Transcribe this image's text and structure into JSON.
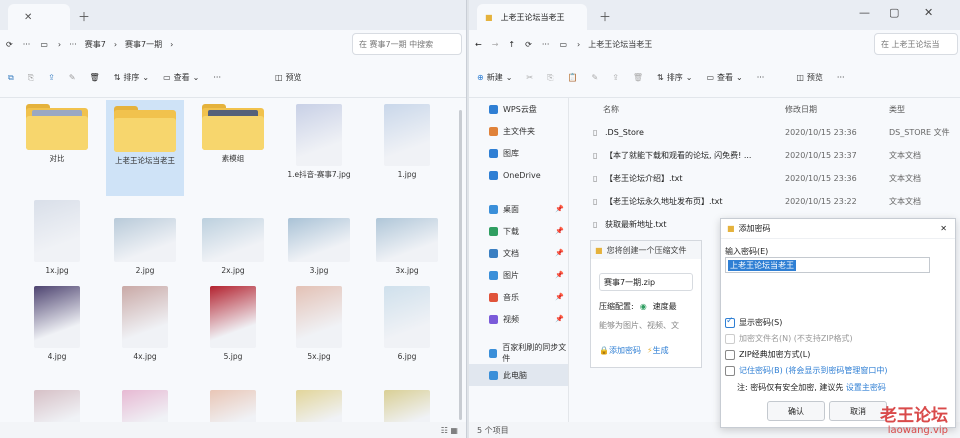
{
  "left": {
    "tab_label": "",
    "breadcrumb": [
      "赛事7",
      "赛事7一期"
    ],
    "search_placeholder": "在 赛事7一期 中搜索",
    "toolbar": {
      "sort": "排序",
      "view": "查看",
      "details": "预览"
    },
    "items": [
      {
        "label": "对比",
        "kind": "folder",
        "thumb": "#9aa8c2"
      },
      {
        "label": "上老王论坛当老王",
        "kind": "folder",
        "selected": true,
        "thumb": ""
      },
      {
        "label": "素模组",
        "kind": "folder",
        "thumb": "#55617a"
      },
      {
        "label": "1.e抖音-赛事7.jpg",
        "kind": "image",
        "thumb": "#c8d0e6"
      },
      {
        "label": "1.jpg",
        "kind": "image",
        "thumb": "#c9d7ea"
      },
      {
        "label": "1x.jpg",
        "kind": "image",
        "thumb": "#d9dfe9"
      },
      {
        "label": "2.jpg",
        "kind": "image",
        "thumb": "#b8cad9"
      },
      {
        "label": "2x.jpg",
        "kind": "image",
        "thumb": "#bcd0de"
      },
      {
        "label": "3.jpg",
        "kind": "image",
        "thumb": "#a9c2d6"
      },
      {
        "label": "3x.jpg",
        "kind": "image",
        "thumb": "#afc6d8"
      },
      {
        "label": "4.jpg",
        "kind": "image",
        "thumb": "#4d4370"
      },
      {
        "label": "4x.jpg",
        "kind": "image",
        "thumb": "#c9a9a6"
      },
      {
        "label": "5.jpg",
        "kind": "image",
        "thumb": "#b3222f"
      },
      {
        "label": "5x.jpg",
        "kind": "image",
        "thumb": "#e3c1b5"
      },
      {
        "label": "6.jpg",
        "kind": "image",
        "thumb": "#cfe0ec"
      },
      {
        "label": "",
        "kind": "image",
        "thumb": "#d6c0c6"
      },
      {
        "label": "",
        "kind": "image",
        "thumb": "#e7b9d3"
      },
      {
        "label": "",
        "kind": "image",
        "thumb": "#e9c6b6"
      },
      {
        "label": "",
        "kind": "image",
        "thumb": "#e2d59a"
      },
      {
        "label": "",
        "kind": "image",
        "thumb": "#d9cf95"
      }
    ]
  },
  "right": {
    "tab_label": "上老王论坛当老王",
    "breadcrumb": [
      "上老王论坛当老王"
    ],
    "search_placeholder": "在 上老王论坛当",
    "toolbar": {
      "new": "新建",
      "sort": "排序",
      "view": "查看",
      "details": "预览"
    },
    "nav": [
      {
        "label": "WPS云盘",
        "icon": "cloud-icon",
        "color": "#2f7fd4"
      },
      {
        "label": "主文件夹",
        "icon": "home-icon",
        "color": "#e0823a"
      },
      {
        "label": "图库",
        "icon": "gallery-icon",
        "color": "#2f7fd4"
      },
      {
        "label": "OneDrive",
        "icon": "onedrive-icon",
        "color": "#2f7fd4"
      },
      {
        "label": "桌面",
        "icon": "desktop-icon",
        "color": "#3a8fd9"
      },
      {
        "label": "下载",
        "icon": "download-icon",
        "color": "#2f9e61"
      },
      {
        "label": "文档",
        "icon": "documents-icon",
        "color": "#3a7fc2"
      },
      {
        "label": "图片",
        "icon": "pictures-icon",
        "color": "#3a8fd9"
      },
      {
        "label": "音乐",
        "icon": "music-icon",
        "color": "#e0533a"
      },
      {
        "label": "视频",
        "icon": "videos-icon",
        "color": "#7a5ad9"
      },
      {
        "label": "百家利刷的同步文件",
        "icon": "sync-folder-icon",
        "color": "#3a8fd9"
      },
      {
        "label": "此电脑",
        "icon": "pc-icon",
        "color": "#3a8fd9"
      }
    ],
    "columns": {
      "name": "名称",
      "date": "修改日期",
      "type": "类型"
    },
    "files": [
      {
        "name": ".DS_Store",
        "date": "2020/10/15 23:36",
        "type": "DS_STORE 文件"
      },
      {
        "name": "【本了就能下载和观看的论坛, 闪免费! ...",
        "date": "2020/10/15 23:37",
        "type": "文本文档"
      },
      {
        "name": "【老王论坛介绍】.txt",
        "date": "2020/10/15 23:36",
        "type": "文本文档"
      },
      {
        "name": "【老王论坛永久地址发布页】.txt",
        "date": "2020/10/15 23:22",
        "type": "文本文档"
      },
      {
        "name": "获取最新地址.txt",
        "date": "",
        "type": ""
      }
    ],
    "status": "5 个项目"
  },
  "zip_dialog": {
    "title": "您将创建一个压缩文件",
    "filename": "赛事7一期.zip",
    "config_label": "压缩配置:",
    "option": "速度最",
    "hint": "能够为图片、视频、文",
    "add_password": "添加密码",
    "generate": "生成"
  },
  "pwd_dialog": {
    "title": "添加密码",
    "input_label": "输入密码(E)",
    "password_value": "上老王论坛当老王",
    "show_password": "显示密码(S)",
    "encrypt_names": "加密文件名(N) (不支持ZIP格式)",
    "zip_legacy": "ZIP经典加密方式(L)",
    "remember": "记住密码(B) (将会显示到密码管理窗口中)",
    "note": "注: 密码仅有安全加密, 建议先",
    "note_link": "设置主密码",
    "ok": "确认",
    "cancel": "取消"
  },
  "watermark": {
    "cn": "老王论坛",
    "url": "laowang.vip"
  }
}
